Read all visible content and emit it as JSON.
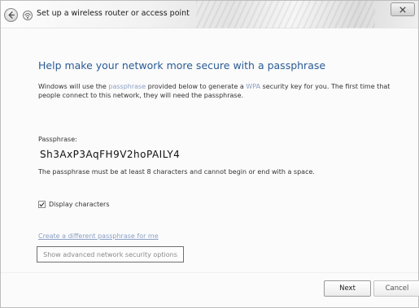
{
  "window": {
    "title": "Set up a wireless router or access point"
  },
  "main": {
    "heading": "Help make your network more secure with a passphrase",
    "description_before": "Windows will use the ",
    "description_link": "passphrase",
    "description_middle": " provided below to generate a ",
    "description_link2": "WPA",
    "description_after": " security key for you. The first time that people connect to this network, they will need the passphrase.",
    "passphrase_label": "Passphrase:",
    "passphrase_value": "Sh3AxP3AqFH9V2hoPAILY4",
    "passphrase_note": "The passphrase must be at least 8 characters and cannot begin or end with a space.",
    "display_characters_label": "Display characters",
    "display_characters_checked": true,
    "different_passphrase_link": "Create a different passphrase for me",
    "advanced_options_label": "Show advanced network security options"
  },
  "footer": {
    "next_label": "Next",
    "cancel_label": "Cancel"
  },
  "colors": {
    "heading": "#2a5b96",
    "link": "#8a9fc4"
  },
  "icons": {
    "back": "back-arrow-icon",
    "wizard": "network-wizard-icon",
    "close": "close-icon",
    "checkbox": "check-icon"
  }
}
